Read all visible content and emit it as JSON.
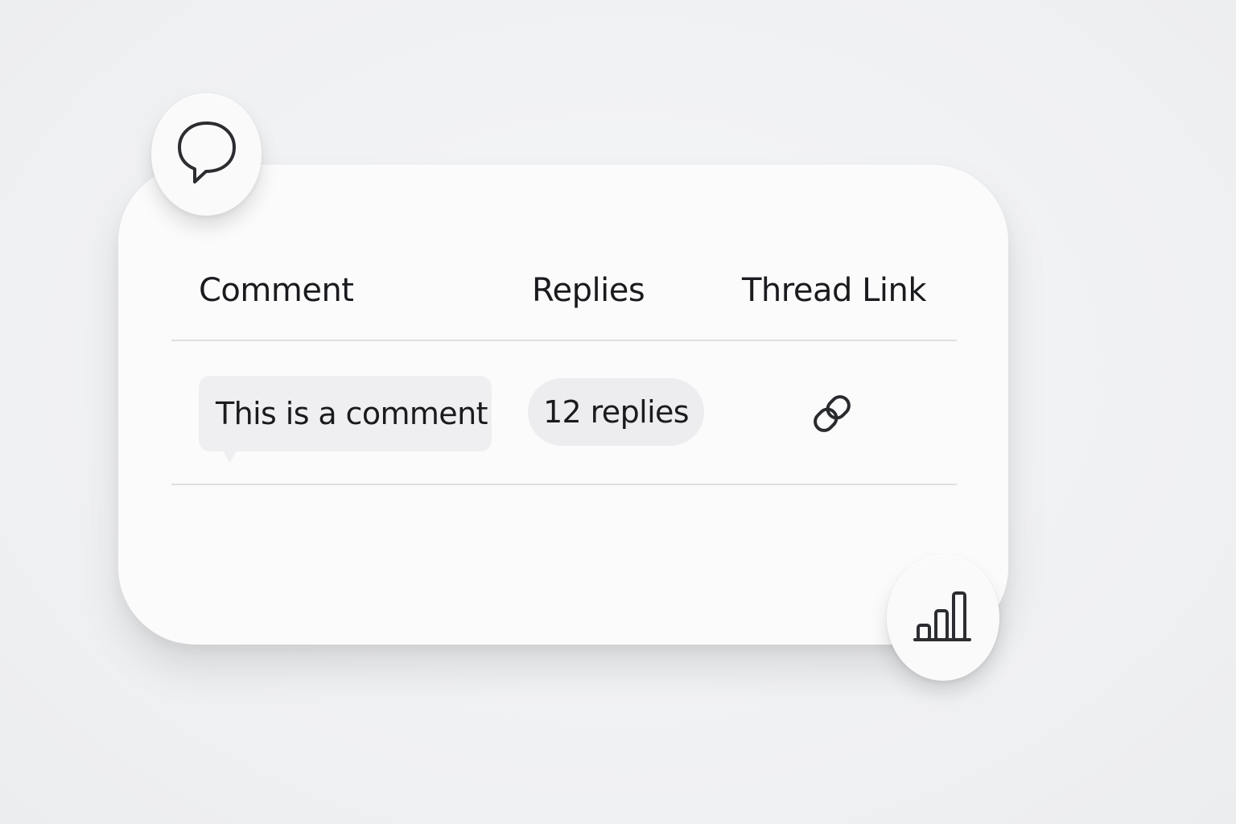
{
  "table": {
    "headers": {
      "comment": "Comment",
      "replies": "Replies",
      "thread_link": "Thread Link"
    },
    "rows": [
      {
        "comment": "This is a comment",
        "replies": "12 replies",
        "thread_link_icon": "link-icon"
      }
    ]
  },
  "floating_buttons": {
    "top_left_icon": "chat-bubble-icon",
    "bottom_right_icon": "bar-chart-icon"
  },
  "colors": {
    "background": "#f0f1f3",
    "card": "#fbfbfc",
    "chip": "#efeff1",
    "text": "#1a1b1e",
    "divider": "#dedfe2"
  }
}
